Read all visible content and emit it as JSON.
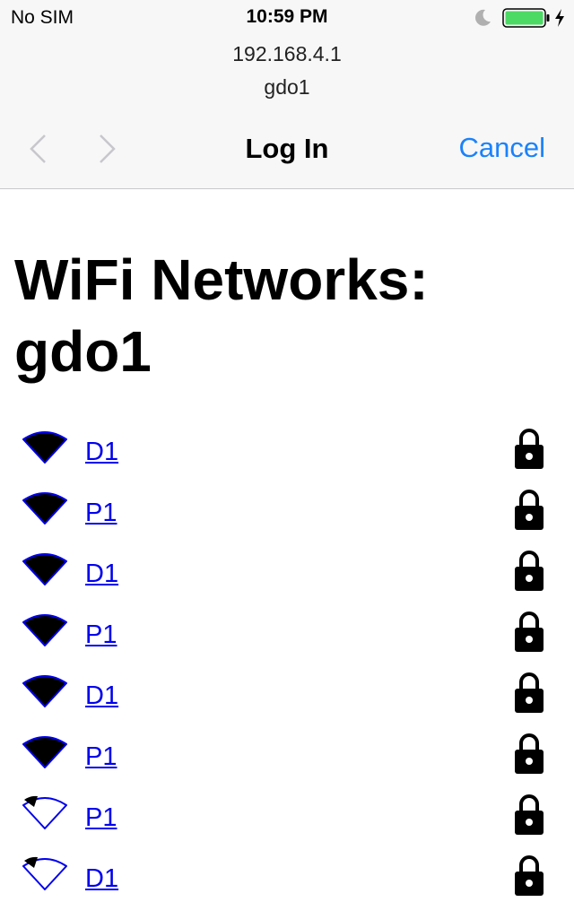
{
  "status_bar": {
    "carrier": "No SIM",
    "time": "10:59 PM",
    "battery_color": "#4cd964"
  },
  "browser": {
    "url": "192.168.4.1",
    "subtitle": "gdo1",
    "title": "Log In",
    "cancel_label": "Cancel",
    "accent_color": "#1a82fb"
  },
  "content": {
    "heading": "WiFi Networks: gdo1",
    "networks": [
      {
        "ssid": "D1",
        "signal": "strong",
        "locked": true
      },
      {
        "ssid": "P1",
        "signal": "strong",
        "locked": true
      },
      {
        "ssid": "D1",
        "signal": "strong",
        "locked": true
      },
      {
        "ssid": "P1",
        "signal": "strong",
        "locked": true
      },
      {
        "ssid": "D1",
        "signal": "strong",
        "locked": true
      },
      {
        "ssid": "P1",
        "signal": "strong",
        "locked": true
      },
      {
        "ssid": "P1",
        "signal": "weak",
        "locked": true
      },
      {
        "ssid": "D1",
        "signal": "weak",
        "locked": true
      }
    ]
  }
}
